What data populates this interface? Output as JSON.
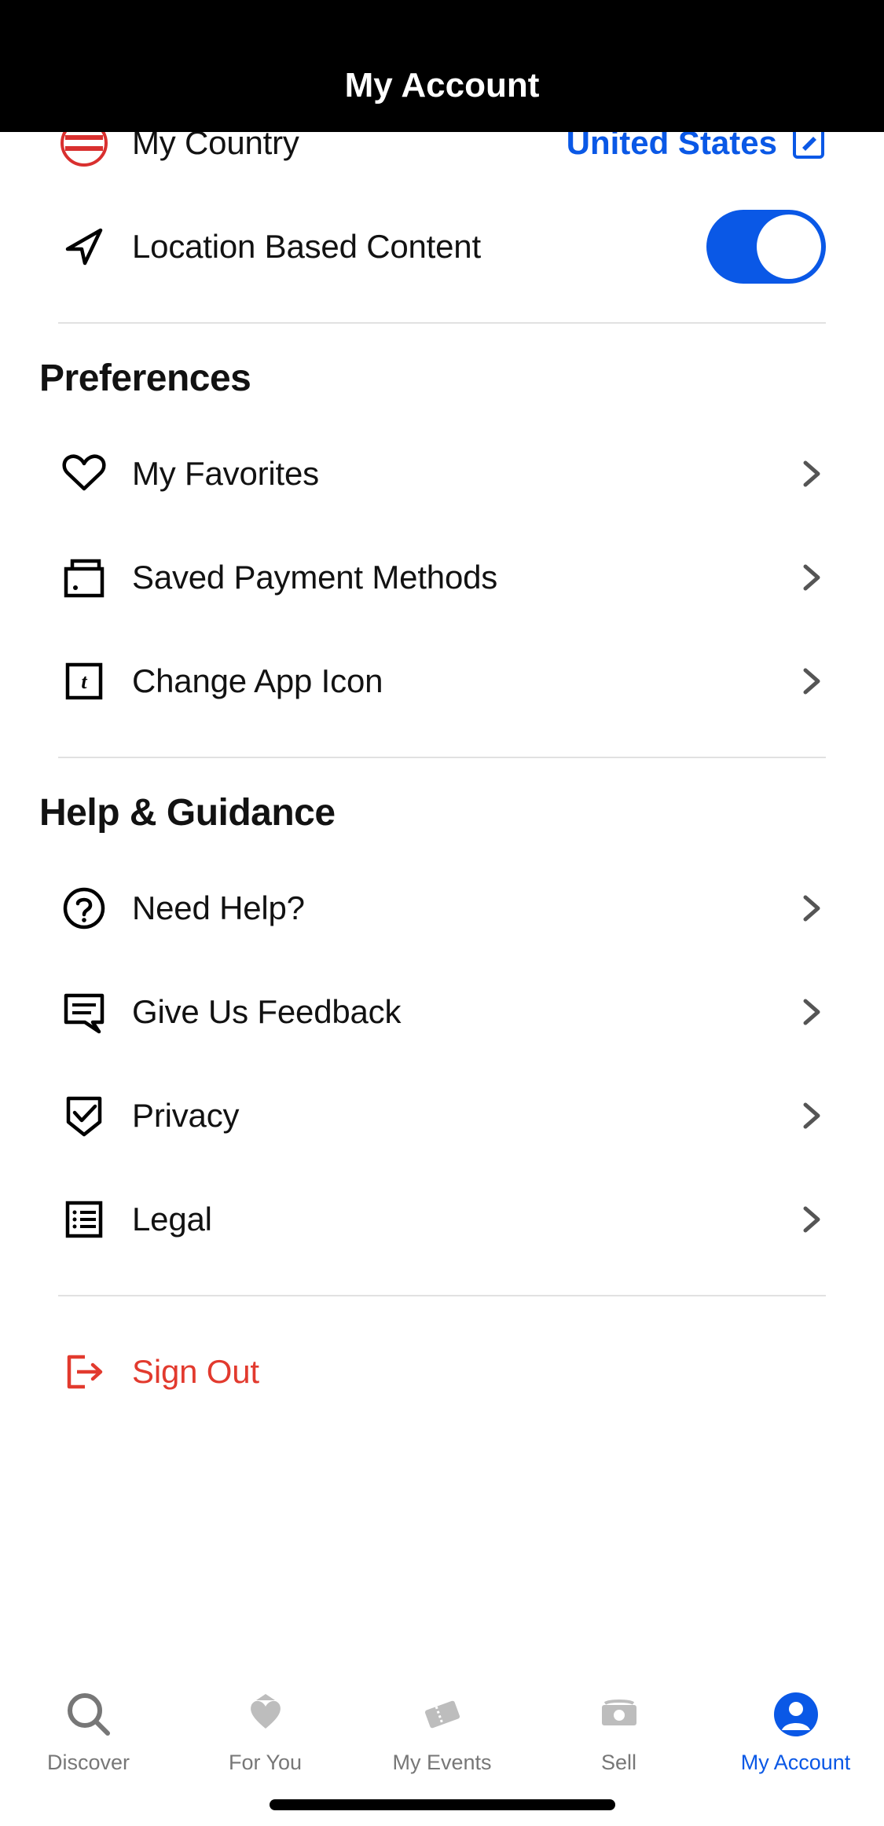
{
  "header": {
    "title": "My Account"
  },
  "settings": {
    "country": {
      "label": "My Country",
      "value": "United States"
    },
    "location": {
      "label": "Location Based Content",
      "enabled": true
    }
  },
  "sections": {
    "preferences": {
      "title": "Preferences",
      "items": {
        "favorites": "My Favorites",
        "payment": "Saved Payment Methods",
        "appicon": "Change App Icon"
      }
    },
    "help": {
      "title": "Help & Guidance",
      "items": {
        "need_help": "Need Help?",
        "feedback": "Give Us Feedback",
        "privacy": "Privacy",
        "legal": "Legal"
      }
    }
  },
  "signout": {
    "label": "Sign Out"
  },
  "tabbar": {
    "discover": "Discover",
    "foryou": "For You",
    "myevents": "My Events",
    "sell": "Sell",
    "account": "My Account"
  }
}
